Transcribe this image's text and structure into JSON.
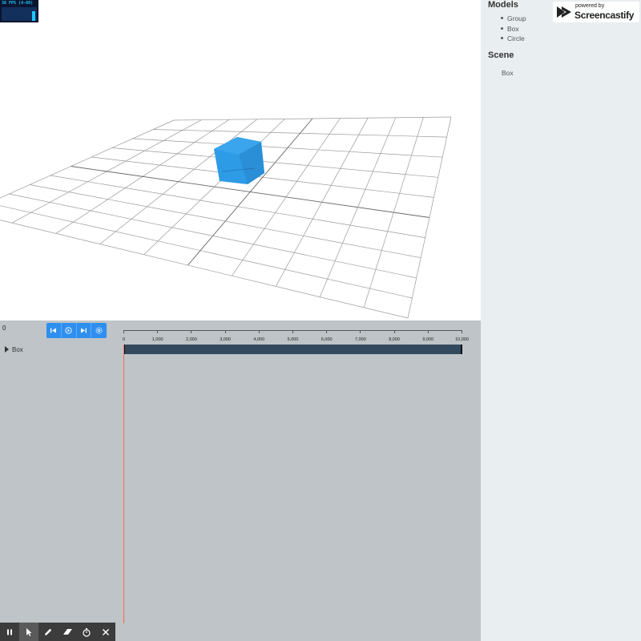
{
  "stats": {
    "fps_text": "36 FPS (4-60)"
  },
  "sidebar": {
    "models_title": "Models",
    "models": [
      "Group",
      "Box",
      "Circle"
    ],
    "scene_title": "Scene",
    "scene_items": [
      "Box"
    ]
  },
  "watermark": {
    "small": "powered by",
    "brand": "Screencastify"
  },
  "timeline": {
    "time_value": "0",
    "controls": [
      "skip-back-icon",
      "play-icon",
      "skip-forward-icon",
      "settings-icon"
    ],
    "track_name": "Box",
    "ruler_labels": [
      "0",
      "1,000",
      "2,000",
      "3,000",
      "4,000",
      "5,000",
      "6,000",
      "7,000",
      "8,000",
      "9,000",
      "10,000"
    ]
  },
  "toolbar": {
    "tools": [
      "pause-icon",
      "cursor-icon",
      "pencil-icon",
      "eraser-icon",
      "timer-icon",
      "close-icon"
    ]
  },
  "colors": {
    "accent": "#2e8ff0",
    "box": "#2e9be6",
    "track": "#34495e",
    "playhead": "#f26c4f",
    "panel": "#bec4c7",
    "sidebar": "#e9eef0"
  }
}
